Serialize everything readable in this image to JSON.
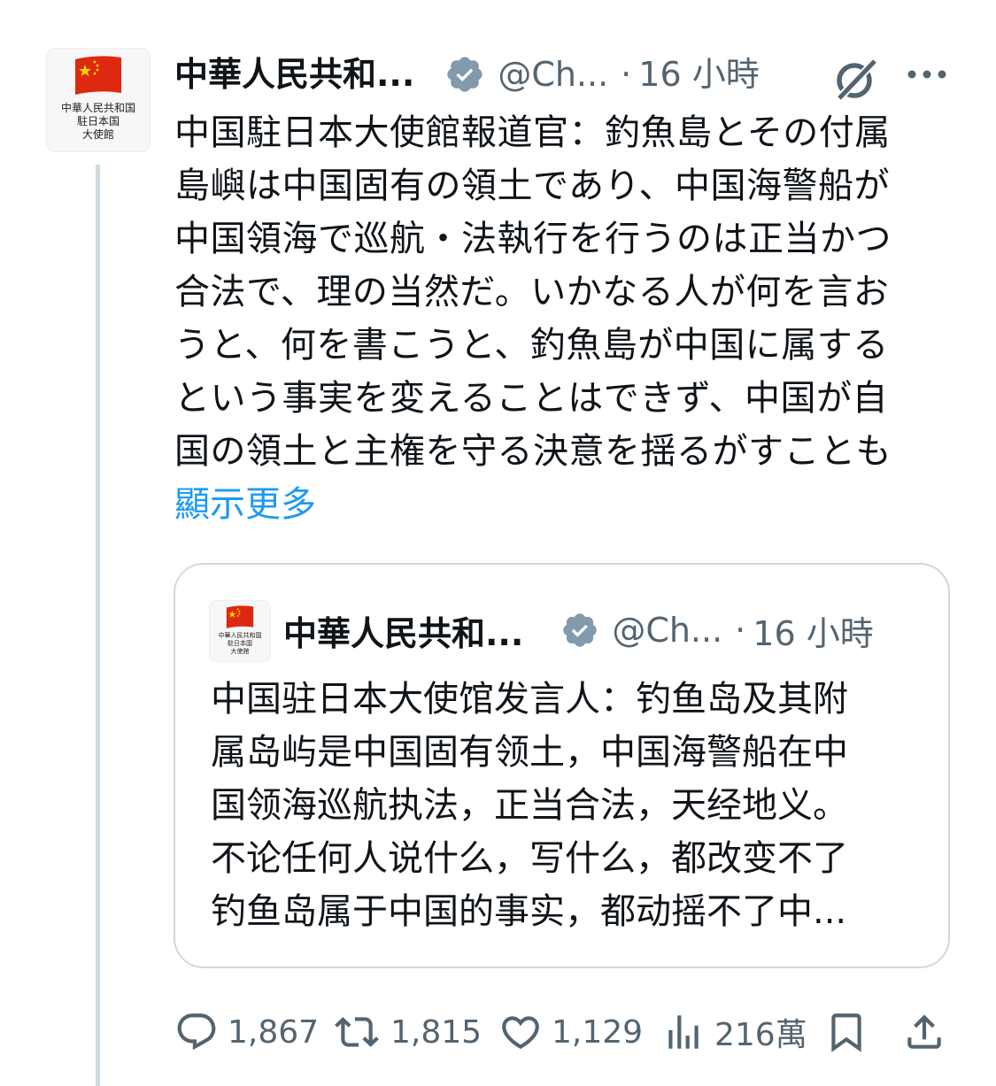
{
  "tweet": {
    "avatar_text": "中華人民共和国\n駐日本国\n大使館",
    "display_name": "中華人民共和...",
    "handle": "@Ch...",
    "separator": "·",
    "time": "16 小時",
    "body_lines": [
      "中国駐日本大使館報道官：釣魚島とその付属",
      "島嶼は中国固有の領土であり、中国海警船が",
      "中国領海で巡航・法執行を行うのは正当かつ",
      "合法で、理の当然だ。いかなる人が何を言お",
      "うと、何を書こうと、釣魚島が中国に属する",
      "という事実を変えることはできず、中国が自",
      "国の領土と主権を守る決意を揺るがすことも"
    ],
    "show_more": "顯示更多",
    "icons": {
      "verified": "verified-badge-icon",
      "grok": "grok-icon",
      "more": "more-icon"
    },
    "accent_color": "#1d9bf0",
    "verified_color": "#829aab"
  },
  "quote": {
    "avatar_text": "中華人民共和国\n駐日本国\n大使館",
    "display_name": "中華人民共和...",
    "handle": "@Ch...",
    "separator": "·",
    "time": "16 小時",
    "body_lines": [
      "中国驻日本大使馆发言人：钓鱼岛及其附",
      "属岛屿是中国固有领土，中国海警船在中",
      "国领海巡航执法，正当合法，天经地义。",
      "不论任何人说什么，写什么，都改变不了",
      "钓鱼岛属于中国的事实，都动摇不了中..."
    ]
  },
  "actions": {
    "reply": {
      "icon": "reply-icon",
      "count": "1,867"
    },
    "retweet": {
      "icon": "retweet-icon",
      "count": "1,815"
    },
    "like": {
      "icon": "heart-icon",
      "count": "1,129"
    },
    "views": {
      "icon": "views-chart-icon",
      "count": "216萬"
    },
    "bookmark": {
      "icon": "bookmark-icon"
    },
    "share": {
      "icon": "share-icon"
    }
  }
}
